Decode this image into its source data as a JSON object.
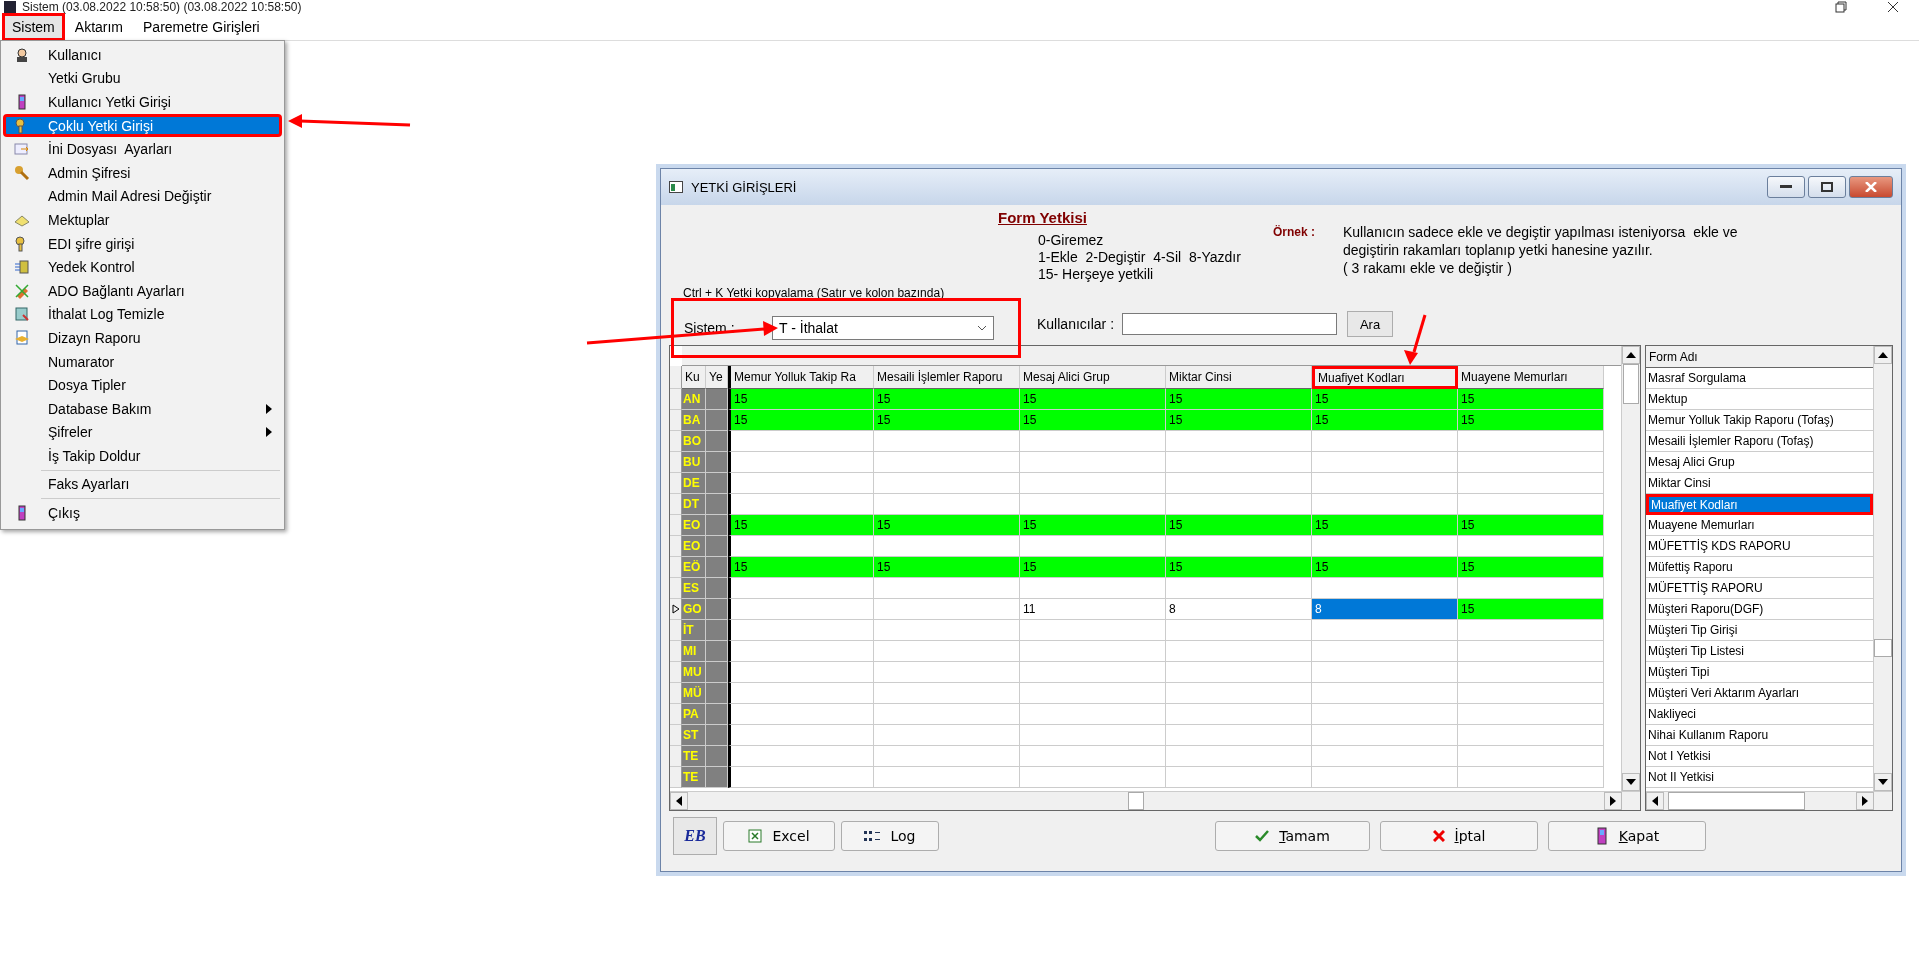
{
  "app_title": "Sistem (03.08.2022 10:58:50) (03.08.2022 10:58:50)",
  "menu_bar": [
    {
      "label": "Sistem",
      "selected": true,
      "highlighted": true
    },
    {
      "label": "Aktarım",
      "selected": false,
      "highlighted": false
    },
    {
      "label": "Paremetre Girişleri",
      "selected": false,
      "highlighted": false
    }
  ],
  "dropdown": {
    "items": [
      {
        "kind": "icon-item",
        "label": "Kullanıcı",
        "selected": false,
        "highlighted": false,
        "submenu": false
      },
      {
        "kind": "item",
        "label": "Yetki Grubu",
        "selected": false,
        "highlighted": false,
        "submenu": false
      },
      {
        "kind": "icon-item",
        "label": "Kullanıcı Yetki Girişi",
        "selected": false,
        "highlighted": false,
        "submenu": false
      },
      {
        "kind": "icon-item",
        "label": "Çoklu Yetki Girişi",
        "selected": true,
        "highlighted": true,
        "submenu": false
      },
      {
        "kind": "icon-item",
        "label": "İni Dosyası  Ayarları",
        "selected": false,
        "highlighted": false,
        "submenu": false
      },
      {
        "kind": "icon-item",
        "label": "Admin Şifresi",
        "selected": false,
        "highlighted": false,
        "submenu": false
      },
      {
        "kind": "item",
        "label": "Admin Mail Adresi Değiştir",
        "selected": false,
        "highlighted": false,
        "submenu": false
      },
      {
        "kind": "icon-item",
        "label": "Mektuplar",
        "selected": false,
        "highlighted": false,
        "submenu": false
      },
      {
        "kind": "icon-item",
        "label": "EDI şifre girişi",
        "selected": false,
        "highlighted": false,
        "submenu": false
      },
      {
        "kind": "icon-item",
        "label": "Yedek Kontrol",
        "selected": false,
        "highlighted": false,
        "submenu": false
      },
      {
        "kind": "icon-item",
        "label": "ADO Bağlantı Ayarları",
        "selected": false,
        "highlighted": false,
        "submenu": false
      },
      {
        "kind": "icon-item",
        "label": "İthalat Log Temizle",
        "selected": false,
        "highlighted": false,
        "submenu": false
      },
      {
        "kind": "icon-item",
        "label": "Dizayn Raporu",
        "selected": false,
        "highlighted": false,
        "submenu": false
      },
      {
        "kind": "item",
        "label": "Numarator",
        "selected": false,
        "highlighted": false,
        "submenu": false
      },
      {
        "kind": "item",
        "label": "Dosya Tipler",
        "selected": false,
        "highlighted": false,
        "submenu": false
      },
      {
        "kind": "item",
        "label": "Database Bakım",
        "selected": false,
        "highlighted": false,
        "submenu": true
      },
      {
        "kind": "item",
        "label": "Şifreler",
        "selected": false,
        "highlighted": false,
        "submenu": true
      },
      {
        "kind": "item",
        "label": "İş Takip Doldur",
        "selected": false,
        "highlighted": false,
        "submenu": false
      },
      {
        "kind": "separator"
      },
      {
        "kind": "item",
        "label": "Faks Ayarları",
        "selected": false,
        "highlighted": false,
        "submenu": false
      },
      {
        "kind": "separator"
      },
      {
        "kind": "icon-item",
        "label": "Çıkış",
        "selected": false,
        "highlighted": false,
        "submenu": false
      }
    ]
  },
  "dialog": {
    "title": "YETKİ GİRİŞLERİ",
    "hint": "Ctrl + K Yetki kopyalama (Satır ve kolon bazında)",
    "legend": {
      "title": "Form Yetkisi",
      "lines": [
        "0-Giremez",
        "1-Ekle  2-Degiştir  4-Sil  8-Yazdır",
        "15- Herşeye yetkili"
      ]
    },
    "example": {
      "label": "Örnek :",
      "lines": [
        "Kullanıcın sadece ekle ve degiştir yapılması isteniyorsa  ekle ve",
        "degiştirin rakamları toplanıp yetki hanesine yazılır.",
        "( 3 rakamı ekle ve değiştir )"
      ]
    },
    "sistem": {
      "label": "Sistem :",
      "value": "T - İthalat",
      "highlighted": true
    },
    "users": {
      "label": "Kullanıcılar :",
      "button": "Ara"
    },
    "grid": {
      "columns": [
        {
          "label": "Ku",
          "highlighted": false
        },
        {
          "label": "Ye",
          "highlighted": false
        },
        {
          "label": "Memur Yolluk Takip Ra",
          "highlighted": false
        },
        {
          "label": "Mesaili İşlemler Raporu",
          "highlighted": false
        },
        {
          "label": "Mesaj Alici Grup",
          "highlighted": false
        },
        {
          "label": "Miktar Cinsi",
          "highlighted": false
        },
        {
          "label": "Muafiyet Kodları",
          "highlighted": true
        },
        {
          "label": "Muayene Memurları",
          "highlighted": false
        }
      ],
      "rows": [
        {
          "current": false,
          "cells": [
            {
              "value": "AN",
              "full": false,
              "selected": false
            },
            {
              "full": false,
              "selected": false
            },
            {
              "value": "15",
              "full": true,
              "selected": false
            },
            {
              "value": "15",
              "full": true,
              "selected": false
            },
            {
              "value": "15",
              "full": true,
              "selected": false
            },
            {
              "value": "15",
              "full": true,
              "selected": false
            },
            {
              "value": "15",
              "full": true,
              "selected": false
            },
            {
              "value": "15",
              "full": true,
              "selected": false
            }
          ]
        },
        {
          "current": false,
          "cells": [
            {
              "value": "BA",
              "full": false,
              "selected": false
            },
            {
              "full": false,
              "selected": false
            },
            {
              "value": "15",
              "full": true,
              "selected": false
            },
            {
              "value": "15",
              "full": true,
              "selected": false
            },
            {
              "value": "15",
              "full": true,
              "selected": false
            },
            {
              "value": "15",
              "full": true,
              "selected": false
            },
            {
              "value": "15",
              "full": true,
              "selected": false
            },
            {
              "value": "15",
              "full": true,
              "selected": false
            }
          ]
        },
        {
          "current": false,
          "cells": [
            {
              "value": "BO",
              "full": false,
              "selected": false
            },
            {
              "full": false,
              "selected": false
            },
            {
              "full": false,
              "selected": false
            },
            {
              "full": false,
              "selected": false
            },
            {
              "full": false,
              "selected": false
            },
            {
              "full": false,
              "selected": false
            },
            {
              "full": false,
              "selected": false
            },
            {
              "full": false,
              "selected": false
            }
          ]
        },
        {
          "current": false,
          "cells": [
            {
              "value": "BU",
              "full": false,
              "selected": false
            },
            {
              "full": false,
              "selected": false
            },
            {
              "full": false,
              "selected": false
            },
            {
              "full": false,
              "selected": false
            },
            {
              "full": false,
              "selected": false
            },
            {
              "full": false,
              "selected": false
            },
            {
              "full": false,
              "selected": false
            },
            {
              "full": false,
              "selected": false
            }
          ]
        },
        {
          "current": false,
          "cells": [
            {
              "value": "DE",
              "full": false,
              "selected": false
            },
            {
              "full": false,
              "selected": false
            },
            {
              "full": false,
              "selected": false
            },
            {
              "full": false,
              "selected": false
            },
            {
              "full": false,
              "selected": false
            },
            {
              "full": false,
              "selected": false
            },
            {
              "full": false,
              "selected": false
            },
            {
              "full": false,
              "selected": false
            }
          ]
        },
        {
          "current": false,
          "cells": [
            {
              "value": "DT",
              "full": false,
              "selected": false
            },
            {
              "full": false,
              "selected": false
            },
            {
              "full": false,
              "selected": false
            },
            {
              "full": false,
              "selected": false
            },
            {
              "full": false,
              "selected": false
            },
            {
              "full": false,
              "selected": false
            },
            {
              "full": false,
              "selected": false
            },
            {
              "full": false,
              "selected": false
            }
          ]
        },
        {
          "current": false,
          "cells": [
            {
              "value": "EO",
              "full": false,
              "selected": false
            },
            {
              "full": false,
              "selected": false
            },
            {
              "value": "15",
              "full": true,
              "selected": false
            },
            {
              "value": "15",
              "full": true,
              "selected": false
            },
            {
              "value": "15",
              "full": true,
              "selected": false
            },
            {
              "value": "15",
              "full": true,
              "selected": false
            },
            {
              "value": "15",
              "full": true,
              "selected": false
            },
            {
              "value": "15",
              "full": true,
              "selected": false
            }
          ]
        },
        {
          "current": false,
          "cells": [
            {
              "value": "EO",
              "full": false,
              "selected": false
            },
            {
              "full": false,
              "selected": false
            },
            {
              "full": false,
              "selected": false
            },
            {
              "full": false,
              "selected": false
            },
            {
              "full": false,
              "selected": false
            },
            {
              "full": false,
              "selected": false
            },
            {
              "full": false,
              "selected": false
            },
            {
              "full": false,
              "selected": false
            }
          ]
        },
        {
          "current": false,
          "cells": [
            {
              "value": "EÖ",
              "full": false,
              "selected": false
            },
            {
              "full": false,
              "selected": false
            },
            {
              "value": "15",
              "full": true,
              "selected": false
            },
            {
              "value": "15",
              "full": true,
              "selected": false
            },
            {
              "value": "15",
              "full": true,
              "selected": false
            },
            {
              "value": "15",
              "full": true,
              "selected": false
            },
            {
              "value": "15",
              "full": true,
              "selected": false
            },
            {
              "value": "15",
              "full": true,
              "selected": false
            }
          ]
        },
        {
          "current": false,
          "cells": [
            {
              "value": "ES",
              "full": false,
              "selected": false
            },
            {
              "full": false,
              "selected": false
            },
            {
              "full": false,
              "selected": false
            },
            {
              "full": false,
              "selected": false
            },
            {
              "full": false,
              "selected": false
            },
            {
              "full": false,
              "selected": false
            },
            {
              "full": false,
              "selected": false
            },
            {
              "full": false,
              "selected": false
            }
          ]
        },
        {
          "current": true,
          "cells": [
            {
              "value": "GO",
              "full": false,
              "selected": false
            },
            {
              "full": false,
              "selected": false
            },
            {
              "full": false,
              "selected": false
            },
            {
              "full": false,
              "selected": false
            },
            {
              "value": "11",
              "full": false,
              "selected": false
            },
            {
              "value": "8",
              "full": false,
              "selected": false
            },
            {
              "value": "8",
              "full": false,
              "selected": true
            },
            {
              "value": "15",
              "full": true,
              "selected": false
            }
          ]
        },
        {
          "current": false,
          "cells": [
            {
              "value": "İT",
              "full": false,
              "selected": false
            },
            {
              "full": false,
              "selected": false
            },
            {
              "full": false,
              "selected": false
            },
            {
              "full": false,
              "selected": false
            },
            {
              "full": false,
              "selected": false
            },
            {
              "full": false,
              "selected": false
            },
            {
              "full": false,
              "selected": false
            },
            {
              "full": false,
              "selected": false
            }
          ]
        },
        {
          "current": false,
          "cells": [
            {
              "value": "MI",
              "full": false,
              "selected": false
            },
            {
              "full": false,
              "selected": false
            },
            {
              "full": false,
              "selected": false
            },
            {
              "full": false,
              "selected": false
            },
            {
              "full": false,
              "selected": false
            },
            {
              "full": false,
              "selected": false
            },
            {
              "full": false,
              "selected": false
            },
            {
              "full": false,
              "selected": false
            }
          ]
        },
        {
          "current": false,
          "cells": [
            {
              "value": "MU",
              "full": false,
              "selected": false
            },
            {
              "full": false,
              "selected": false
            },
            {
              "full": false,
              "selected": false
            },
            {
              "full": false,
              "selected": false
            },
            {
              "full": false,
              "selected": false
            },
            {
              "full": false,
              "selected": false
            },
            {
              "full": false,
              "selected": false
            },
            {
              "full": false,
              "selected": false
            }
          ]
        },
        {
          "current": false,
          "cells": [
            {
              "value": "MÜ",
              "full": false,
              "selected": false
            },
            {
              "full": false,
              "selected": false
            },
            {
              "full": false,
              "selected": false
            },
            {
              "full": false,
              "selected": false
            },
            {
              "full": false,
              "selected": false
            },
            {
              "full": false,
              "selected": false
            },
            {
              "full": false,
              "selected": false
            },
            {
              "full": false,
              "selected": false
            }
          ]
        },
        {
          "current": false,
          "cells": [
            {
              "value": "PA",
              "full": false,
              "selected": false
            },
            {
              "full": false,
              "selected": false
            },
            {
              "full": false,
              "selected": false
            },
            {
              "full": false,
              "selected": false
            },
            {
              "full": false,
              "selected": false
            },
            {
              "full": false,
              "selected": false
            },
            {
              "full": false,
              "selected": false
            },
            {
              "full": false,
              "selected": false
            }
          ]
        },
        {
          "current": false,
          "cells": [
            {
              "value": "ST",
              "full": false,
              "selected": false
            },
            {
              "full": false,
              "selected": false
            },
            {
              "full": false,
              "selected": false
            },
            {
              "full": false,
              "selected": false
            },
            {
              "full": false,
              "selected": false
            },
            {
              "full": false,
              "selected": false
            },
            {
              "full": false,
              "selected": false
            },
            {
              "full": false,
              "selected": false
            }
          ]
        },
        {
          "current": false,
          "cells": [
            {
              "value": "TE",
              "full": false,
              "selected": false
            },
            {
              "full": false,
              "selected": false
            },
            {
              "full": false,
              "selected": false
            },
            {
              "full": false,
              "selected": false
            },
            {
              "full": false,
              "selected": false
            },
            {
              "full": false,
              "selected": false
            },
            {
              "full": false,
              "selected": false
            },
            {
              "full": false,
              "selected": false
            }
          ]
        },
        {
          "current": false,
          "cells": [
            {
              "value": "TE",
              "full": false,
              "selected": false
            },
            {
              "full": false,
              "selected": false
            },
            {
              "full": false,
              "selected": false
            },
            {
              "full": false,
              "selected": false
            },
            {
              "full": false,
              "selected": false
            },
            {
              "full": false,
              "selected": false
            },
            {
              "full": false,
              "selected": false
            },
            {
              "full": false,
              "selected": false
            }
          ]
        }
      ]
    },
    "form_list": {
      "header": "Form Adı",
      "items": [
        {
          "label": "Masraf Sorgulama",
          "selected": false,
          "highlighted": false
        },
        {
          "label": "Mektup",
          "selected": false,
          "highlighted": false
        },
        {
          "label": "Memur Yolluk Takip Raporu (Tofaş)",
          "selected": false,
          "highlighted": false
        },
        {
          "label": "Mesaili İşlemler Raporu (Tofaş)",
          "selected": false,
          "highlighted": false
        },
        {
          "label": "Mesaj Alici Grup",
          "selected": false,
          "highlighted": false
        },
        {
          "label": "Miktar Cinsi",
          "selected": false,
          "highlighted": false
        },
        {
          "label": "Muafiyet Kodları",
          "selected": true,
          "highlighted": true
        },
        {
          "label": "Muayene Memurları",
          "selected": false,
          "highlighted": false
        },
        {
          "label": "MÜFETTİŞ KDS RAPORU",
          "selected": false,
          "highlighted": false
        },
        {
          "label": "Müfettiş Raporu",
          "selected": false,
          "highlighted": false
        },
        {
          "label": "MÜFETTİŞ RAPORU",
          "selected": false,
          "highlighted": false
        },
        {
          "label": "Müşteri Raporu(DGF)",
          "selected": false,
          "highlighted": false
        },
        {
          "label": "Müşteri Tip Girişi",
          "selected": false,
          "highlighted": false
        },
        {
          "label": "Müşteri Tip Listesi",
          "selected": false,
          "highlighted": false
        },
        {
          "label": "Müşteri Tipi",
          "selected": false,
          "highlighted": false
        },
        {
          "label": "Müşteri Veri Aktarım Ayarları",
          "selected": false,
          "highlighted": false
        },
        {
          "label": "Nakliyeci",
          "selected": false,
          "highlighted": false
        },
        {
          "label": "Nihai Kullanım Raporu",
          "selected": false,
          "highlighted": false
        },
        {
          "label": "Not I Yetkisi",
          "selected": false,
          "highlighted": false
        },
        {
          "label": "Not II Yetkisi",
          "selected": false,
          "highlighted": false
        }
      ]
    },
    "buttons": [
      {
        "kind": "logo",
        "label": "EB",
        "accel": false
      },
      {
        "kind": "excel",
        "label": "Excel",
        "accel": false
      },
      {
        "kind": "log",
        "label": "Log",
        "accel": false
      },
      {
        "kind": "ok",
        "label": "Tamam",
        "accel": true
      },
      {
        "kind": "cancel",
        "label": "İptal",
        "accel": true
      },
      {
        "kind": "close",
        "label": "Kapat",
        "accel": true
      }
    ]
  }
}
